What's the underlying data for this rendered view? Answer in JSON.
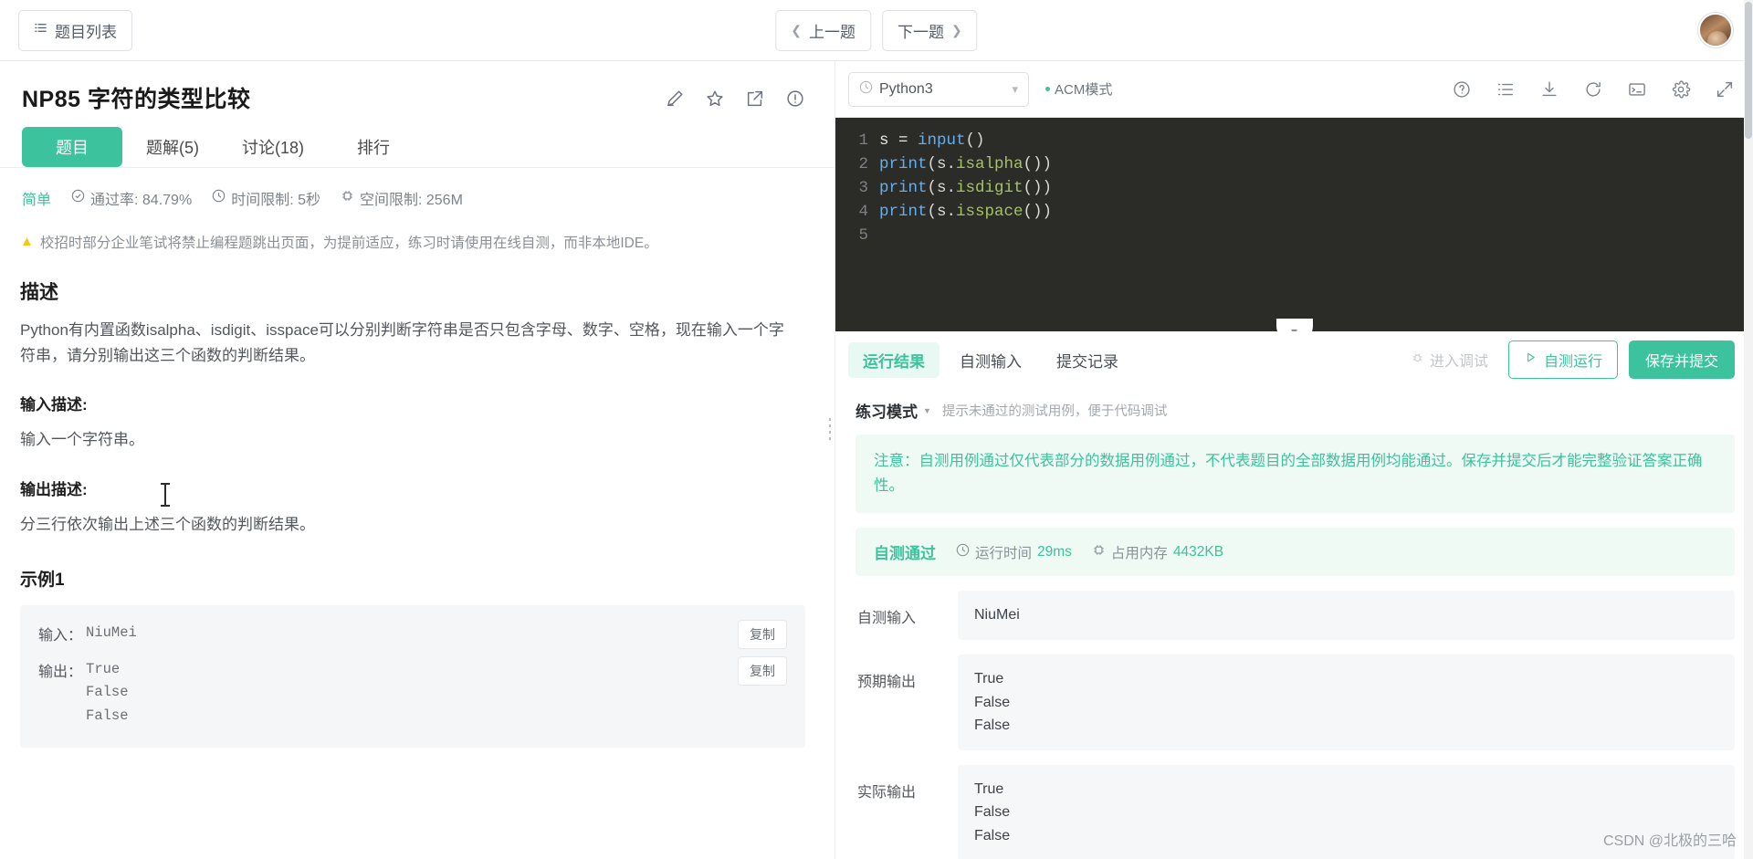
{
  "topbar": {
    "list_button": "题目列表",
    "list_icon": "list-icon",
    "prev_button": "上一题",
    "next_button": "下一题",
    "avatar_name": "user-avatar"
  },
  "problem": {
    "title": "NP85  字符的类型比较",
    "tabs": [
      {
        "label": "题目",
        "active": true
      },
      {
        "label": "题解(5)",
        "active": false
      },
      {
        "label": "讨论(18)",
        "active": false
      },
      {
        "label": "排行",
        "active": false
      }
    ],
    "title_icons": [
      "edit-icon",
      "star-icon",
      "share-icon",
      "info-icon"
    ],
    "meta": {
      "difficulty": "简单",
      "pass_rate": "通过率: 84.79%",
      "time_limit": "时间限制: 5秒",
      "space_limit": "空间限制: 256M"
    },
    "warning": "校招时部分企业笔试将禁止编程题跳出页面，为提前适应，练习时请使用在线自测，而非本地IDE。",
    "description_heading": "描述",
    "description_body": "Python有内置函数isalpha、isdigit、isspace可以分别判断字符串是否只包含字母、数字、空格，现在输入一个字符串，请分别输出这三个函数的判断结果。",
    "input_heading": "输入描述:",
    "input_body": "输入一个字符串。",
    "output_heading": "输出描述:",
    "output_body": "分三行依次输出上述三个函数的判断结果。",
    "example_heading": "示例1",
    "example": {
      "input_label": "输入：",
      "input_value": "NiuMei",
      "output_label": "输出：",
      "output_value": "True\nFalse\nFalse",
      "copy_label": "复制"
    }
  },
  "editor": {
    "language": "Python3",
    "language_icon": "clock-icon",
    "dropdown_icon": "chevron-down-icon",
    "mode_label": "ACM模式",
    "tools": [
      "help-icon",
      "list-icon",
      "download-icon",
      "reset-icon",
      "console-icon",
      "settings-icon",
      "fullscreen-icon"
    ],
    "collapse_icon": "chevron-down-icon",
    "code_lines": [
      {
        "num": "1",
        "tokens": [
          {
            "t": "s = ",
            "c": "plain"
          },
          {
            "t": "input",
            "c": "fn"
          },
          {
            "t": "()",
            "c": "punct"
          }
        ]
      },
      {
        "num": "2",
        "tokens": [
          {
            "t": "print",
            "c": "fn"
          },
          {
            "t": "(s.",
            "c": "punct"
          },
          {
            "t": "isalpha",
            "c": "meth"
          },
          {
            "t": "())",
            "c": "punct"
          }
        ]
      },
      {
        "num": "3",
        "tokens": [
          {
            "t": "print",
            "c": "fn"
          },
          {
            "t": "(s.",
            "c": "punct"
          },
          {
            "t": "isdigit",
            "c": "meth"
          },
          {
            "t": "())",
            "c": "punct"
          }
        ]
      },
      {
        "num": "4",
        "tokens": [
          {
            "t": "print",
            "c": "fn"
          },
          {
            "t": "(s.",
            "c": "punct"
          },
          {
            "t": "isspace",
            "c": "meth"
          },
          {
            "t": "())",
            "c": "punct"
          }
        ]
      },
      {
        "num": "5",
        "tokens": [
          {
            "t": "",
            "c": "plain"
          }
        ]
      }
    ]
  },
  "results": {
    "tabs": [
      {
        "label": "运行结果",
        "active": true
      },
      {
        "label": "自测输入",
        "active": false
      },
      {
        "label": "提交记录",
        "active": false
      }
    ],
    "debug_button": "进入调试",
    "debug_icon": "bug-icon",
    "run_button": "自测运行",
    "run_icon": "play-icon",
    "submit_button": "保存并提交",
    "mode_name": "练习模式",
    "mode_hint": "提示未通过的测试用例，便于代码调试",
    "notice": "注意：自测用例通过仅代表部分的数据用例通过，不代表题目的全部数据用例均能通过。保存并提交后才能完整验证答案正确性。",
    "status": "自测通过",
    "runtime_label": "运行时间",
    "runtime_value": "29ms",
    "memory_label": "占用内存",
    "memory_value": "4432KB",
    "io": [
      {
        "label": "自测输入",
        "value": "NiuMei"
      },
      {
        "label": "预期输出",
        "value": "True\nFalse\nFalse"
      },
      {
        "label": "实际输出",
        "value": "True\nFalse\nFalse"
      }
    ]
  },
  "watermark": "CSDN @北极的三哈",
  "colors": {
    "accent": "#3cc29c",
    "accent_soft": "#effaf5",
    "editor_bg": "#2b2b28",
    "warning": "#f5c518"
  }
}
